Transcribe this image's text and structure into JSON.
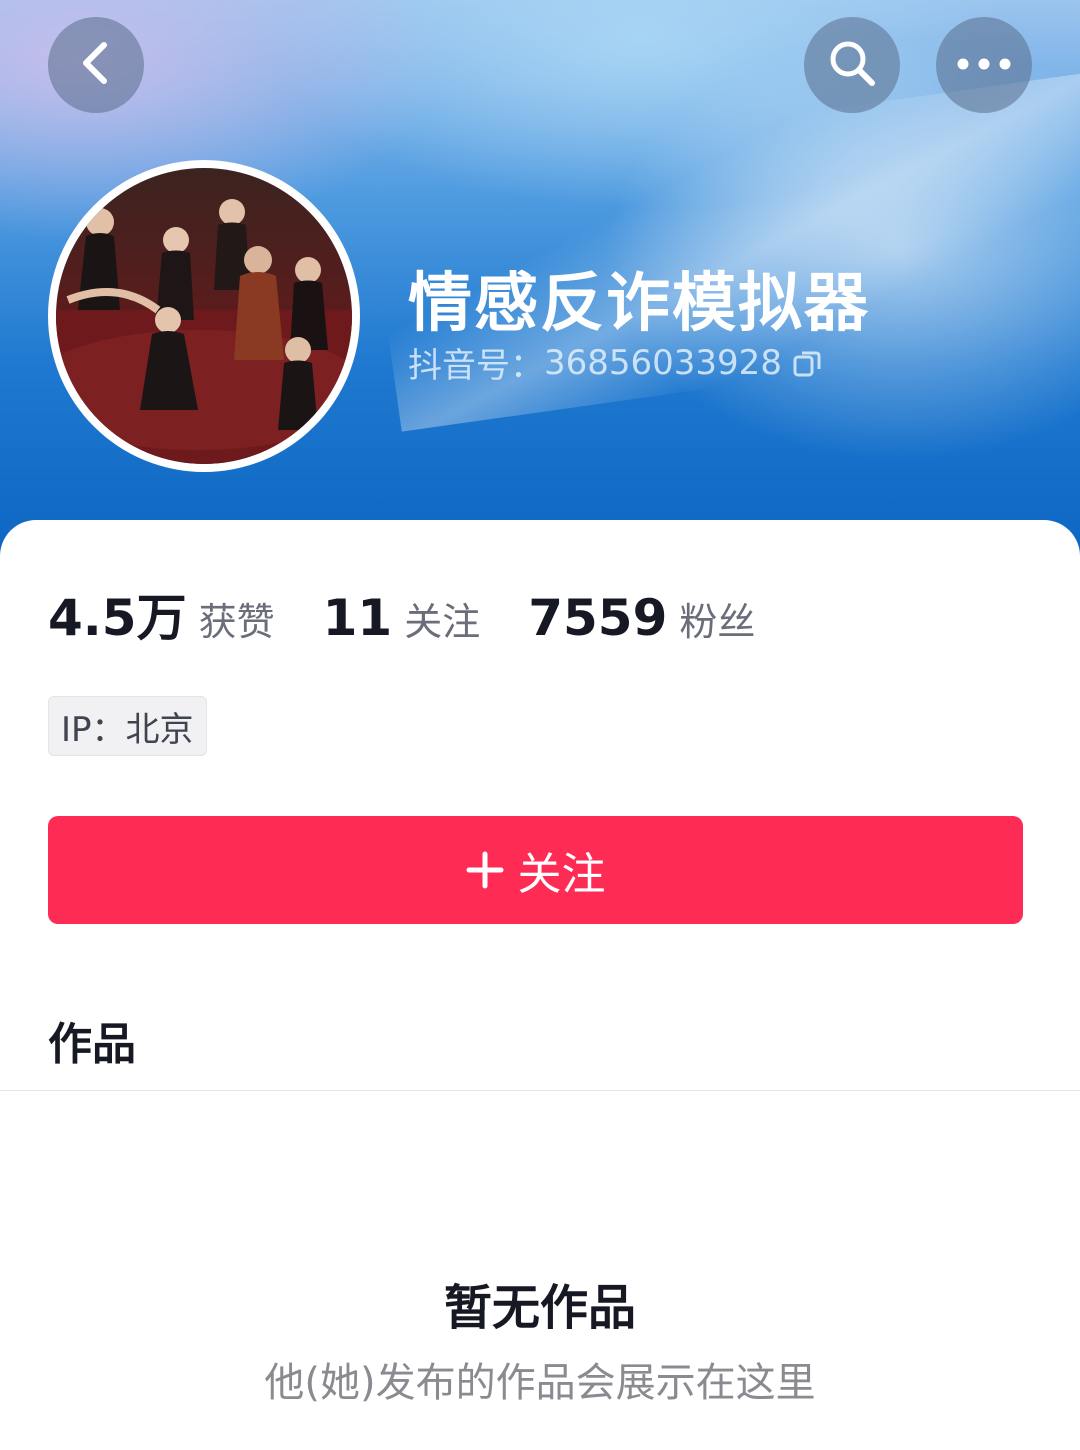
{
  "header": {
    "back_icon": "chevron-left-icon",
    "search_icon": "search-icon",
    "more_icon": "more-horizontal-icon"
  },
  "profile": {
    "nickname": "情感反诈模拟器",
    "douyin_id_label": "抖音号：",
    "douyin_id_value": "36856033928",
    "copy_icon": "copy-icon"
  },
  "stats": [
    {
      "value": "4.5万",
      "label": "获赞"
    },
    {
      "value": "11",
      "label": "关注"
    },
    {
      "value": "7559",
      "label": "粉丝"
    }
  ],
  "ip_tag": "IP：北京",
  "follow_button": {
    "label": "关注",
    "icon": "plus-icon",
    "color": "#fe2c55"
  },
  "works": {
    "tab_label": "作品",
    "empty_title": "暂无作品",
    "empty_subtitle": "他(她)发布的作品会展示在这里"
  },
  "colors": {
    "banner_blue": "#1f79d0",
    "accent_red": "#fe2c55",
    "text_primary": "#161823",
    "text_secondary": "#6b6e7a"
  }
}
